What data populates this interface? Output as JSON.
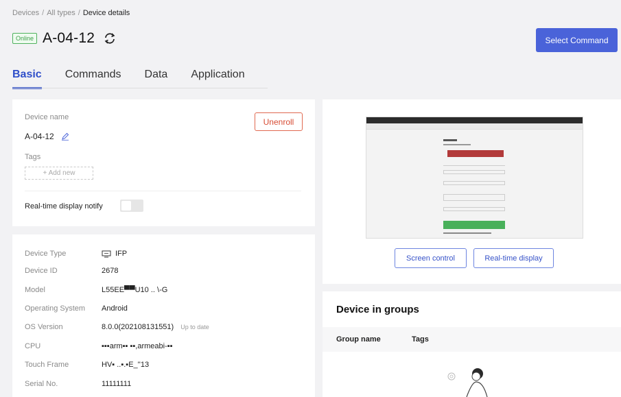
{
  "breadcrumb": {
    "items": [
      "Devices",
      "All types",
      "Device details"
    ],
    "separator": "/"
  },
  "header": {
    "status_badge": "Online",
    "device_title": "A-04-12",
    "select_command_label": "Select Command"
  },
  "tabs": [
    {
      "label": "Basic",
      "active": true
    },
    {
      "label": "Commands",
      "active": false
    },
    {
      "label": "Data",
      "active": false
    },
    {
      "label": "Application",
      "active": false
    }
  ],
  "basic_card": {
    "device_name_label": "Device name",
    "device_name_value": "A-04-12",
    "unenroll_label": "Unenroll",
    "tags_label": "Tags",
    "add_new_label": "+ Add new",
    "realtime_notify_label": "Real-time display notify",
    "realtime_notify_on": false
  },
  "info": [
    {
      "label": "Device Type",
      "value": "IFP",
      "icon": "monitor-icon"
    },
    {
      "label": "Device ID",
      "value": "2678"
    },
    {
      "label": "Model",
      "value": "L55EE▀▀U10 .. \\-G"
    },
    {
      "label": "Operating System",
      "value": "Android"
    },
    {
      "label": "OS Version",
      "value": "8.0.0(202108131551)",
      "note": "Up to date"
    },
    {
      "label": "CPU",
      "value": "▪▪▪arm▪▪ ▪▪,armeabi-▪▪"
    },
    {
      "label": "Touch Frame",
      "value": "HV▪ ..▪.▪E_''13"
    },
    {
      "label": "Serial No.",
      "value": "11111111"
    }
  ],
  "screen_card": {
    "screen_control_label": "Screen control",
    "realtime_display_label": "Real-time display"
  },
  "groups": {
    "title": "Device in groups",
    "columns": [
      "Group name",
      "Tags"
    ]
  },
  "colors": {
    "primary": "#4a63d9",
    "online": "#4fb15d",
    "danger": "#e0684f"
  }
}
